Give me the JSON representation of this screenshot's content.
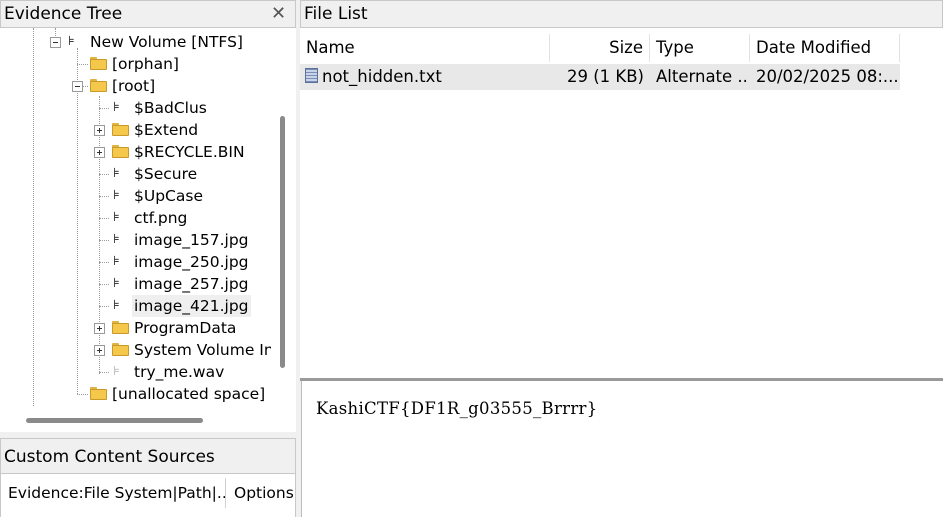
{
  "evidence_tree": {
    "title": "Evidence Tree",
    "close_glyph": "✕",
    "nodes": [
      {
        "label": "New Volume [NTFS]",
        "icon": "tree-icon"
      },
      {
        "label": "[orphan]",
        "icon": "folder-icon"
      },
      {
        "label": "[root]",
        "icon": "folder-icon",
        "expanded": true
      },
      {
        "label": "$BadClus",
        "icon": "tree-file-icon"
      },
      {
        "label": "$Extend",
        "icon": "folder-icon",
        "expandable": true
      },
      {
        "label": "$RECYCLE.BIN",
        "icon": "folder-icon",
        "expandable": true
      },
      {
        "label": "$Secure",
        "icon": "tree-file-icon"
      },
      {
        "label": "$UpCase",
        "icon": "tree-file-icon"
      },
      {
        "label": "ctf.png",
        "icon": "tree-file-icon"
      },
      {
        "label": "image_157.jpg",
        "icon": "tree-file-icon"
      },
      {
        "label": "image_250.jpg",
        "icon": "tree-file-icon"
      },
      {
        "label": "image_257.jpg",
        "icon": "tree-file-icon"
      },
      {
        "label": "image_421.jpg",
        "icon": "tree-file-icon",
        "selected": true
      },
      {
        "label": "ProgramData",
        "icon": "folder-icon",
        "expandable": true
      },
      {
        "label": "System Volume Info",
        "icon": "folder-icon",
        "expandable": true
      },
      {
        "label": "try_me.wav",
        "icon": "tree-file-icon-faded"
      },
      {
        "label": "[unallocated space]",
        "icon": "folder-icon"
      }
    ]
  },
  "custom_content_sources": {
    "title": "Custom Content Sources",
    "column1": "Evidence:File System|Path|...",
    "column2": "Options"
  },
  "file_list": {
    "title": "File List",
    "columns": [
      "Name",
      "Size",
      "Type",
      "Date Modified"
    ],
    "rows": [
      {
        "name": "not_hidden.txt",
        "size": "29 (1 KB)",
        "type": "Alternate ...",
        "date_modified": "20/02/2025 08:..."
      }
    ]
  },
  "viewer": {
    "content": "KashiCTF{DF1R_g03555_Brrrr}"
  }
}
